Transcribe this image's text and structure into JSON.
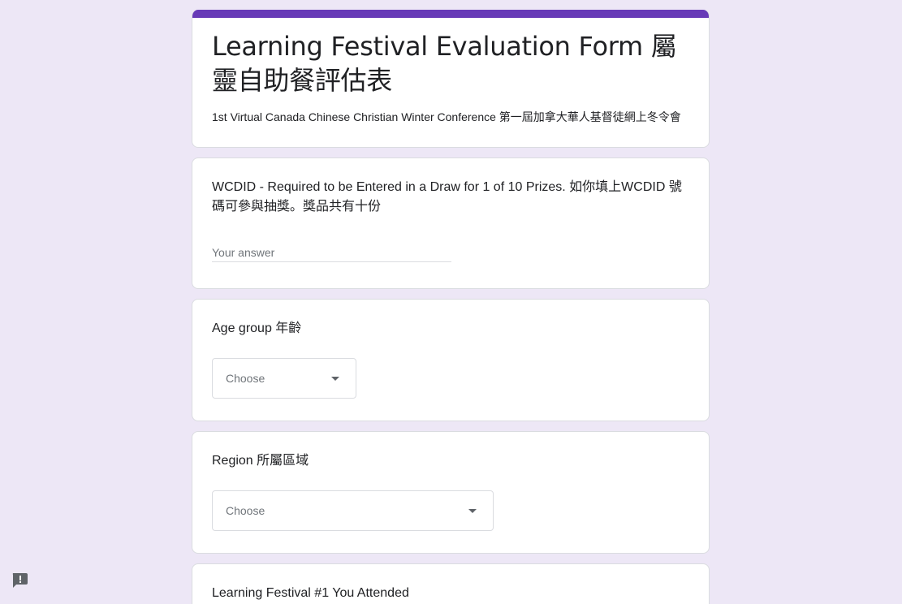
{
  "form": {
    "title": "Learning Festival Evaluation Form 屬靈自助餐評估表",
    "description": "1st Virtual Canada Chinese Christian Winter Conference 第一屆加拿大華人基督徒網上冬令會",
    "accent_color": "#673ab7",
    "background_color": "#ede7f6"
  },
  "questions": [
    {
      "title": "WCDID - Required to be Entered in a Draw for 1 of 10 Prizes. 如你填上WCDID 號碼可參與抽獎。獎品共有十份",
      "placeholder": "Your answer",
      "value": ""
    },
    {
      "title": "Age group 年齡",
      "selected": "Choose"
    },
    {
      "title": "Region 所屬區域",
      "selected": "Choose"
    },
    {
      "title": "Learning Festival #1 You Attended"
    }
  ],
  "icons": {
    "report": "report-problem-icon",
    "dropdown": "arrow-drop-down-icon"
  }
}
